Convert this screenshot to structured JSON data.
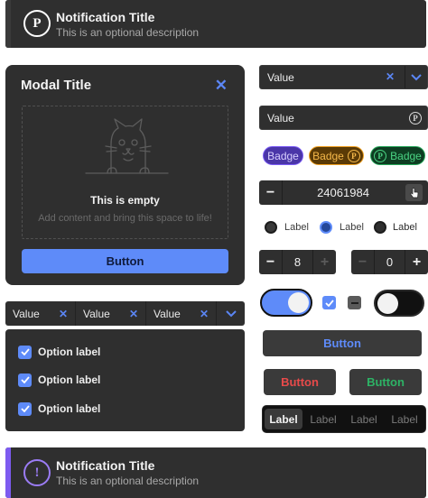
{
  "notification_top": {
    "icon": "p-circle-icon",
    "icon_glyph": "P",
    "title": "Notification Title",
    "description": "This is an optional description",
    "accent": "#3a3a3a"
  },
  "notification_bottom": {
    "icon": "exclamation-circle-icon",
    "icon_glyph": "!",
    "title": "Notification Title",
    "description": "This is an optional description",
    "accent": "#7d5bf0"
  },
  "modal": {
    "title": "Modal Title",
    "close_icon": "close-icon",
    "empty_title": "This is empty",
    "empty_description": "Add content and bring this space to life!",
    "button_label": "Button"
  },
  "multiselect": {
    "chips": [
      {
        "label": "Value"
      },
      {
        "label": "Value"
      },
      {
        "label": "Value"
      }
    ],
    "dropdown_icon": "chevron-down-icon"
  },
  "options": [
    {
      "label": "Option label",
      "checked": true
    },
    {
      "label": "Option label",
      "checked": true
    },
    {
      "label": "Option label",
      "checked": true
    }
  ],
  "select_top": {
    "value": "Value"
  },
  "select_second": {
    "value": "Value",
    "icon": "p-circle-icon"
  },
  "badges": [
    {
      "label": "Badge",
      "color": "#7b5bf5"
    },
    {
      "label": "Badge",
      "color": "#f0a020"
    },
    {
      "label": "Badge",
      "color": "#26a85a"
    }
  ],
  "number_input": {
    "value": "24061984",
    "minus": "−",
    "cursor_icon": "hand-pointer-icon"
  },
  "radios": [
    {
      "label": "Label",
      "state": "disabled"
    },
    {
      "label": "Label",
      "state": "selected"
    },
    {
      "label": "Label",
      "state": "unselected"
    }
  ],
  "stepper_a": {
    "value": "8",
    "minus": "−",
    "plus": "+"
  },
  "stepper_b": {
    "value": "0",
    "minus": "−",
    "plus": "+"
  },
  "toggles": {
    "toggle_on": true,
    "toggle_off": false
  },
  "buttons": {
    "primary": "Button",
    "danger": "Button",
    "success": "Button"
  },
  "segmented": [
    "Label",
    "Label",
    "Label",
    "Label"
  ],
  "colors": {
    "accent_blue": "#5e8bf9",
    "danger_red": "#e84a4a",
    "success_green": "#2db365",
    "surface": "#2f2f2f"
  }
}
